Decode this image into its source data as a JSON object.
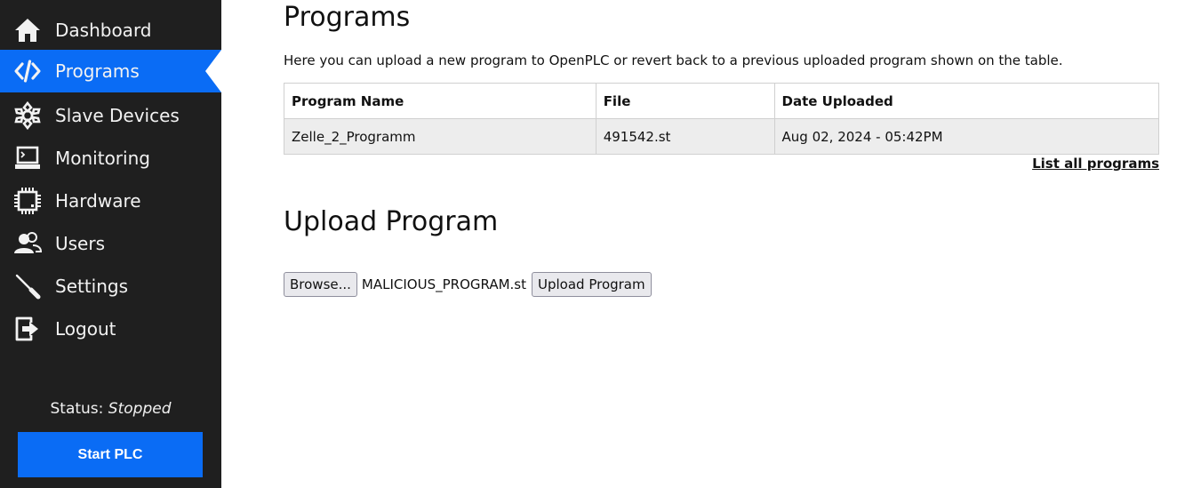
{
  "sidebar": {
    "items": [
      {
        "label": "Dashboard",
        "icon": "home-icon",
        "active": false
      },
      {
        "label": "Programs",
        "icon": "code-icon",
        "active": true
      },
      {
        "label": "Slave Devices",
        "icon": "network-icon",
        "active": false
      },
      {
        "label": "Monitoring",
        "icon": "monitor-icon",
        "active": false
      },
      {
        "label": "Hardware",
        "icon": "chip-icon",
        "active": false
      },
      {
        "label": "Users",
        "icon": "users-icon",
        "active": false
      },
      {
        "label": "Settings",
        "icon": "wrench-icon",
        "active": false
      },
      {
        "label": "Logout",
        "icon": "logout-icon",
        "active": false
      }
    ],
    "status_label": "Status:",
    "status_value": "Stopped",
    "start_button": "Start PLC"
  },
  "main": {
    "title": "Programs",
    "intro": "Here you can upload a new program to OpenPLC or revert back to a previous uploaded program shown on the table.",
    "table": {
      "headers": [
        "Program Name",
        "File",
        "Date Uploaded"
      ],
      "rows": [
        [
          "Zelle_2_Programm",
          "491542.st",
          "Aug 02, 2024 - 05:42PM"
        ]
      ]
    },
    "list_all_link": "List all programs",
    "upload_title": "Upload Program",
    "browse_button": "Browse...",
    "selected_file": "MALICIOUS_PROGRAM.st",
    "upload_button": "Upload Program"
  },
  "colors": {
    "sidebar_bg": "#1f1f1f",
    "accent": "#0a6cf5",
    "table_row_bg": "#ededed"
  }
}
